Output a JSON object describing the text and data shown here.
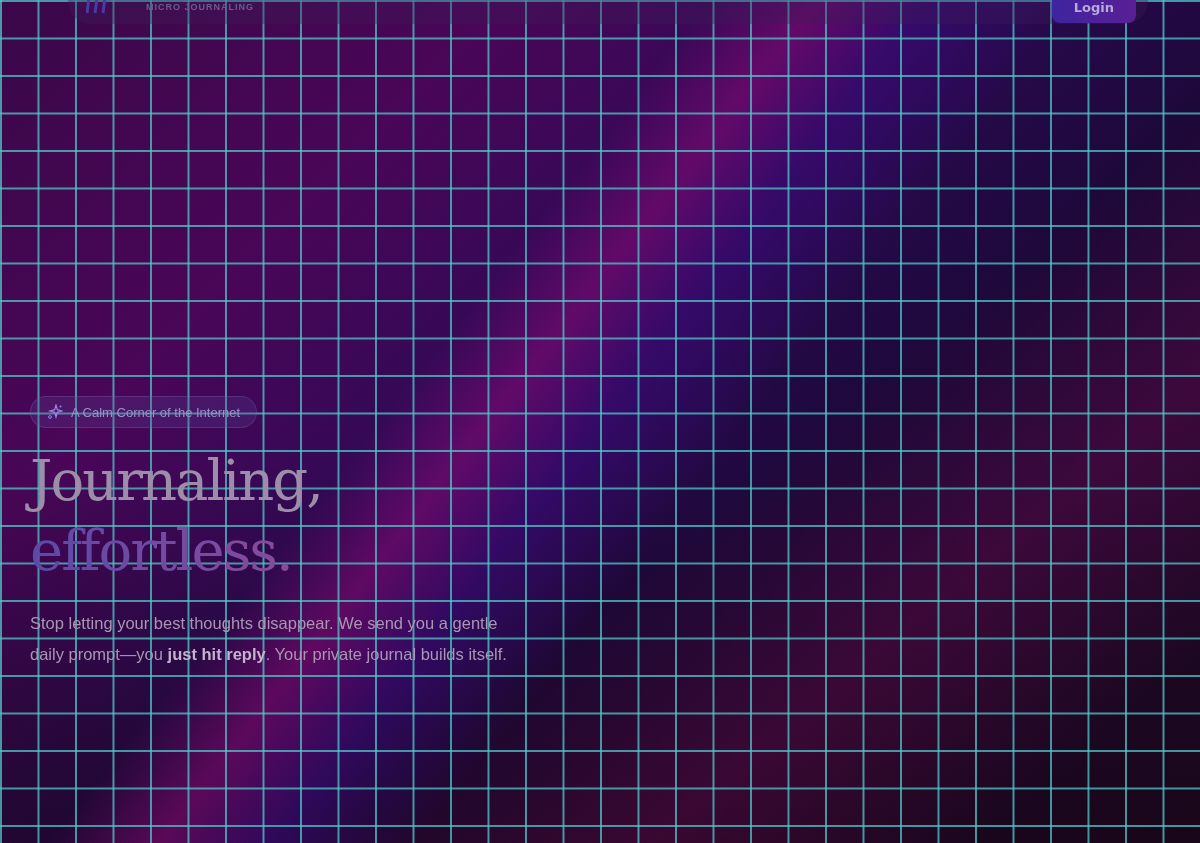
{
  "nav": {
    "tagline": "MICRO JOURNALING",
    "login_button": "Login"
  },
  "hero": {
    "badge": "A Calm Corner of the Internet",
    "title_line_1": "Journaling,",
    "title_line_2": "effortless.",
    "description": "Stop letting your best thoughts disappear. We send you a gentle daily prompt—you **just hit reply**. Your private journal builds itself."
  }
}
